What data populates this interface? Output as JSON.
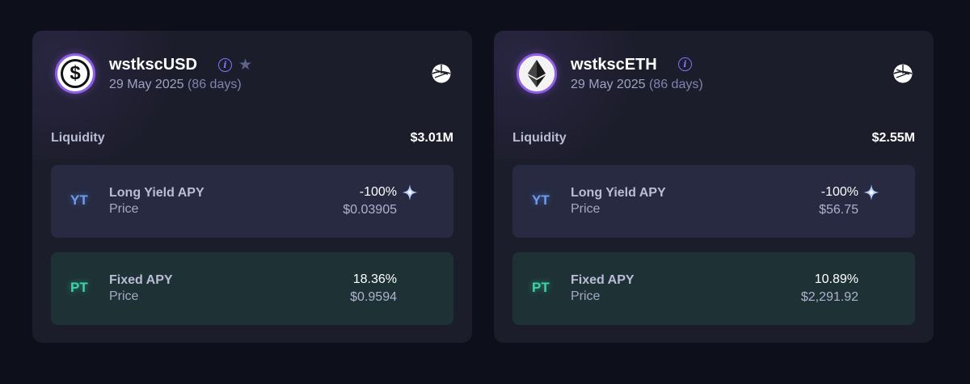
{
  "colors": {
    "page_bg": "#0d0f1b",
    "card_bg": "#1c1d2b",
    "yt_row_bg": "#272a40",
    "pt_row_bg": "#1e3236",
    "yt_accent": "#6d9df0",
    "pt_accent": "#3fd3a6",
    "info_accent": "#7b76ff",
    "logo_ring": "#8f5fe6"
  },
  "markets": [
    {
      "token_name": "wstkscUSD",
      "token_icon": "dollar-icon",
      "maturity_date": "29 May 2025",
      "maturity_days": "(86 days)",
      "has_star": true,
      "protocol_icon": "sonic-logo-icon",
      "liquidity_label": "Liquidity",
      "liquidity_value": "$3.01M",
      "yt": {
        "badge": "YT",
        "label": "Long Yield APY",
        "sub": "Price",
        "apy": "-100%",
        "price": "$0.03905"
      },
      "pt": {
        "badge": "PT",
        "label": "Fixed APY",
        "sub": "Price",
        "apy": "18.36%",
        "price": "$0.9594"
      }
    },
    {
      "token_name": "wstkscETH",
      "token_icon": "ethereum-icon",
      "maturity_date": "29 May 2025",
      "maturity_days": "(86 days)",
      "has_star": false,
      "protocol_icon": "sonic-logo-icon",
      "liquidity_label": "Liquidity",
      "liquidity_value": "$2.55M",
      "yt": {
        "badge": "YT",
        "label": "Long Yield APY",
        "sub": "Price",
        "apy": "-100%",
        "price": "$56.75"
      },
      "pt": {
        "badge": "PT",
        "label": "Fixed APY",
        "sub": "Price",
        "apy": "10.89%",
        "price": "$2,291.92"
      }
    }
  ]
}
